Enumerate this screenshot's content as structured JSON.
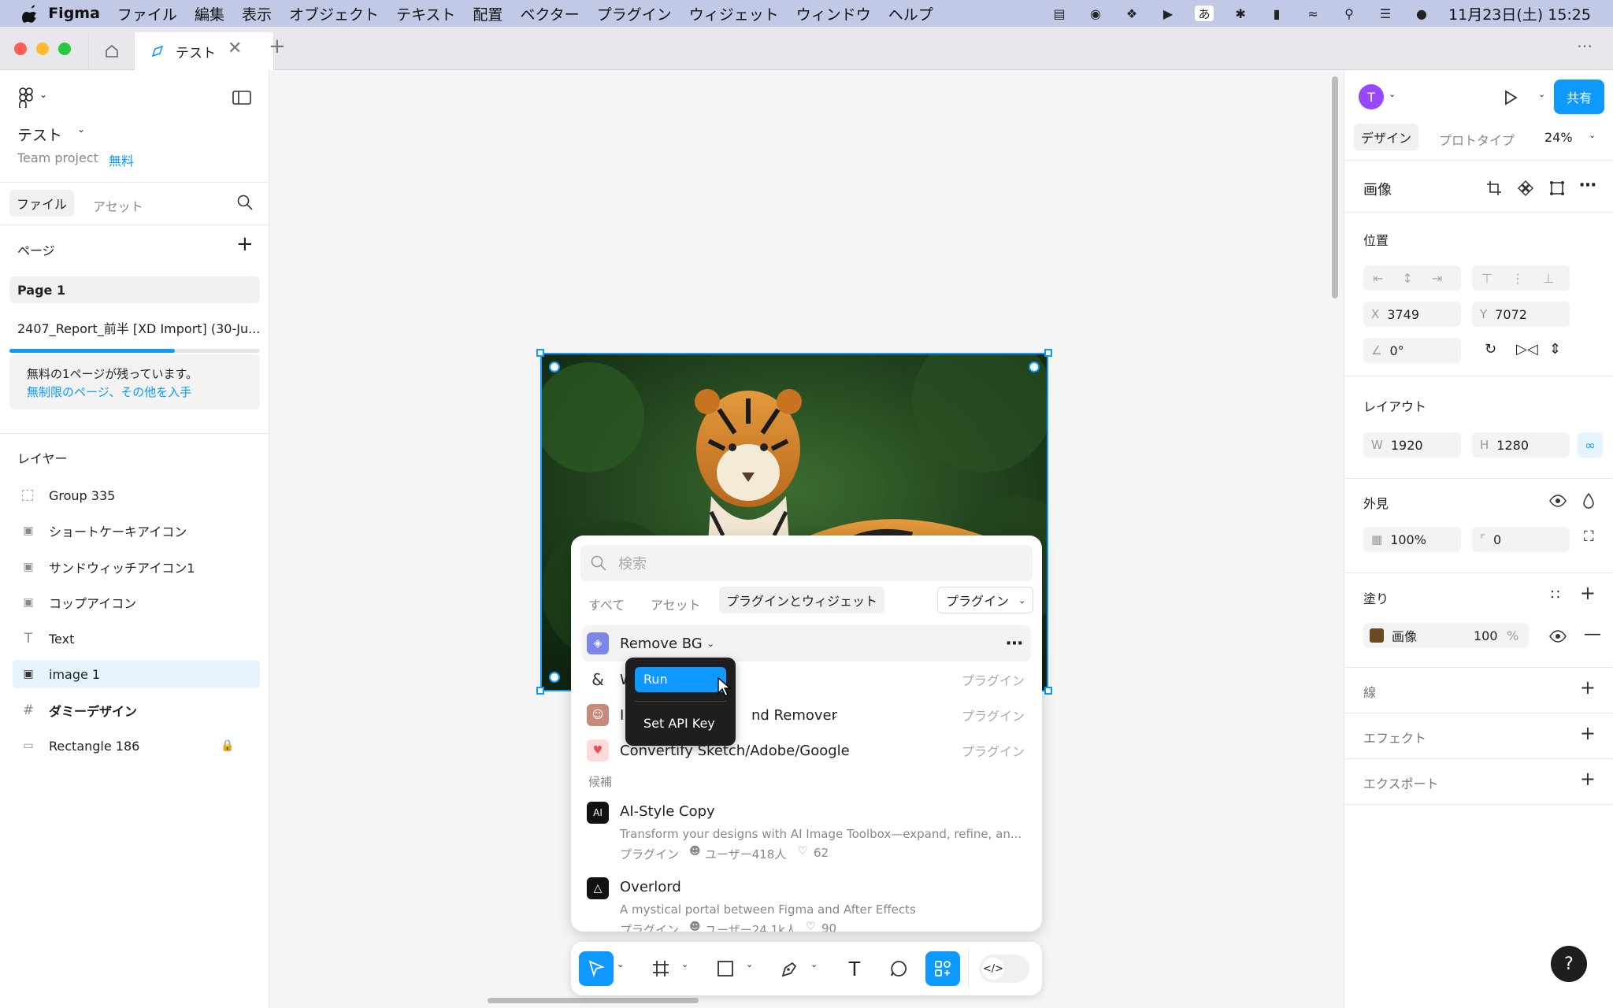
{
  "menubar": {
    "app": "Figma",
    "items": [
      "ファイル",
      "編集",
      "表示",
      "オブジェクト",
      "テキスト",
      "配置",
      "ベクター",
      "プラグイン",
      "ウィジェット",
      "ウィンドウ",
      "ヘルプ"
    ],
    "ime": "あ",
    "clock": "11月23日(土) 15:25"
  },
  "tabs": {
    "active_label": "テスト"
  },
  "left": {
    "file_name": "テスト",
    "team": "Team project",
    "plan": "無料",
    "tab_files": "ファイル",
    "tab_assets": "アセット",
    "pages_label": "ページ",
    "pages": [
      "Page 1",
      "2407_Report_前半 [XD Import] (30-Ju..."
    ],
    "notice_line1": "無料の1ページが残っています。",
    "notice_link": "無制限のページ、その他を入手",
    "layers_label": "レイヤー",
    "layers": [
      "Group 335",
      "ショートケーキアイコン",
      "サンドウィッチアイコン1",
      "コップアイコン",
      "Text",
      "image 1",
      "ダミーデザイン",
      "Rectangle 186"
    ]
  },
  "popup": {
    "search_placeholder": "検索",
    "filters": [
      "すべて",
      "アセット",
      "プラグインとウィジェット"
    ],
    "type_dropdown": "プラグイン",
    "rows": [
      {
        "name": "Remove BG",
        "tag": ""
      },
      {
        "name": "W",
        "tag": "プラグイン"
      },
      {
        "name_left": "I",
        "name_right": "nd Remover",
        "tag": "プラグイン"
      },
      {
        "name": "Convertify Sketch/Adobe/Google",
        "tag": "プラグイン"
      }
    ],
    "suggest_label": "候補",
    "suggestions": [
      {
        "name": "AI-Style Copy",
        "desc": "Transform your designs with AI Image Toolbox—expand, refine, an...",
        "type": "プラグイン",
        "users": "ユーザー418人",
        "likes": "62"
      },
      {
        "name": "Overlord",
        "desc": "A mystical portal between Figma and After Effects",
        "type": "プラグイン",
        "users": "ユーザー24.1k人",
        "likes": "90"
      }
    ],
    "context_menu": [
      "Run",
      "Set API Key"
    ]
  },
  "right": {
    "avatar_letter": "T",
    "share": "共有",
    "tab_design": "デザイン",
    "tab_prototype": "プロトタイプ",
    "zoom": "24%",
    "section_title": "画像",
    "position_label": "位置",
    "x_label": "X",
    "x": "3749",
    "y_label": "Y",
    "y": "7072",
    "rotation": "0°",
    "layout_label": "レイアウト",
    "w_label": "W",
    "w": "1920",
    "h_label": "H",
    "h": "1280",
    "appearance_label": "外見",
    "opacity": "100%",
    "radius": "0",
    "fill_label": "塗り",
    "fill_name": "画像",
    "fill_opacity": "100",
    "fill_pct": "%",
    "stroke_label": "線",
    "effect_label": "エフェクト",
    "export_label": "エクスポート",
    "help": "?"
  },
  "colors": {
    "accent": "#0d99ff",
    "menubar": "#c2c9e6",
    "selection": "#e5f4ff"
  }
}
